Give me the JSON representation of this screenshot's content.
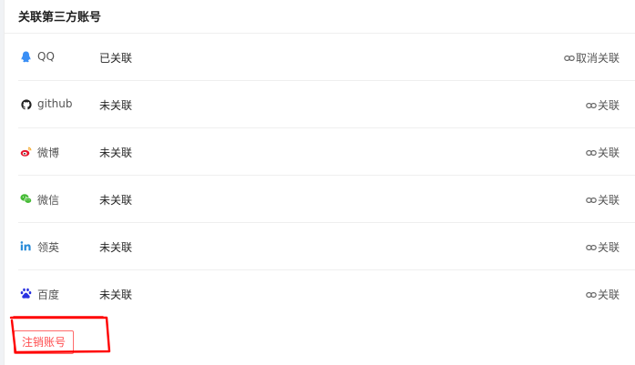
{
  "page": {
    "title": "关联第三方账号"
  },
  "accounts": [
    {
      "name": "QQ",
      "status": "已关联",
      "action": "取消关联",
      "icon": "qq-icon"
    },
    {
      "name": "github",
      "status": "未关联",
      "action": "关联",
      "icon": "github-icon"
    },
    {
      "name": "微博",
      "status": "未关联",
      "action": "关联",
      "icon": "weibo-icon"
    },
    {
      "name": "微信",
      "status": "未关联",
      "action": "关联",
      "icon": "wechat-icon"
    },
    {
      "name": "领英",
      "status": "未关联",
      "action": "关联",
      "icon": "linkedin-icon"
    },
    {
      "name": "百度",
      "status": "未关联",
      "action": "关联",
      "icon": "baidu-icon"
    }
  ],
  "footer": {
    "cancel_account_label": "注销账号"
  },
  "colors": {
    "qq": "#3a8ff5",
    "github": "#222222",
    "weibo": "#e6162d",
    "wechat": "#46bb36",
    "linkedin": "#2b8cd8",
    "baidu": "#2932e1",
    "danger": "#ff4d4f",
    "annotation": "#ff0000"
  }
}
